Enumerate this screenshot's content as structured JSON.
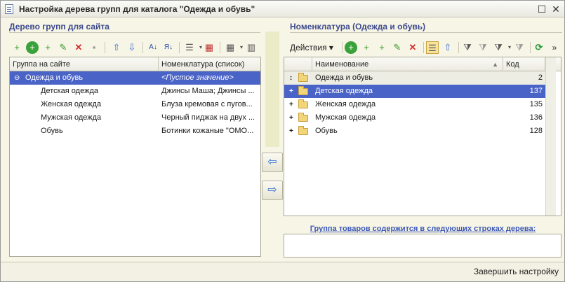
{
  "window": {
    "title": "Настройка дерева групп для каталога \"Одежда и обувь\"",
    "minimize_glyph": "☐",
    "close_glyph": "✕"
  },
  "left": {
    "title": "Дерево групп для сайта",
    "columns": [
      "Группа на сайте",
      "Номенклатура (список)"
    ],
    "rows": [
      {
        "name": "Одежда и обувь",
        "items": "<Пустое значение>",
        "expander": "⊖"
      },
      {
        "name": "Детская одежда",
        "items": "Джинсы Маша; Джинсы ..."
      },
      {
        "name": "Женская одежда",
        "items": "Блуза кремовая с пугов..."
      },
      {
        "name": "Мужская одежда",
        "items": "Черный пиджак на двух ..."
      },
      {
        "name": "Обувь",
        "items": "Ботинки кожаные \"ОМО..."
      }
    ]
  },
  "right": {
    "title": "Номенклатура (Одежда и обувь)",
    "actions_label": "Действия ▾",
    "columns": [
      "Наименование",
      "Код"
    ],
    "sort_glyph": "▲",
    "rows": [
      {
        "name": "Одежда и обувь",
        "code": "2",
        "expander": "↕"
      },
      {
        "name": "Детская одежда",
        "code": "137",
        "expander": "+"
      },
      {
        "name": "Женская одежда",
        "code": "135",
        "expander": "+"
      },
      {
        "name": "Мужская одежда",
        "code": "136",
        "expander": "+"
      },
      {
        "name": "Обувь",
        "code": "128",
        "expander": "+"
      }
    ]
  },
  "move_right_glyph": "⇦",
  "move_left_glyph": "⇨",
  "info_label": "Группа товаров содержится в следующих строках дерева:",
  "finish_label": "Завершить настройку",
  "icons": {
    "add": "+",
    "add_copy": "+",
    "add_folder": "+",
    "edit": "✎",
    "delete": "✕",
    "save": "▪",
    "up": "⇧",
    "down": "⇩",
    "sort_az": "A↓",
    "sort_za": "Я↓",
    "list": "☰",
    "cols": "▦",
    "report": "▥",
    "refresh": "⟳",
    "more": "»",
    "filter": "⧩",
    "dropdown_glyph": "▾"
  }
}
